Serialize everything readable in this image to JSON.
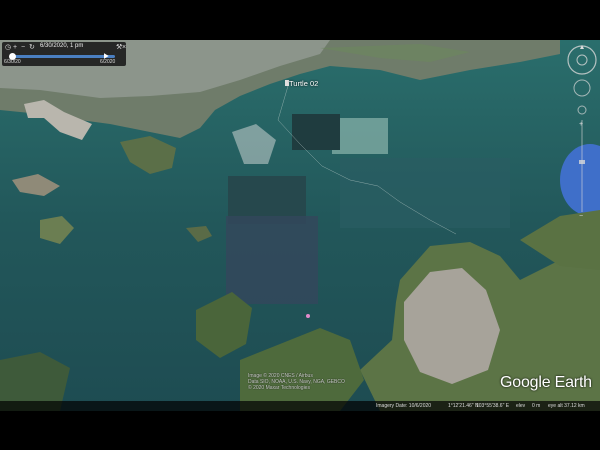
{
  "app": {
    "logo": "Google Earth"
  },
  "timebar": {
    "date_label": "6/30/2020, 1 pm",
    "start_label": "6/30/20",
    "end_label": "6/2020",
    "progress": 0.92
  },
  "placemark": {
    "label": "Turtle 02",
    "icon": "placemark-icon"
  },
  "copyright": {
    "line1": "Image © 2020 CNES / Airbus",
    "line2": "Data SIO, NOAA, U.S. Navy, NGA, GEBCO",
    "line3": "© 2020 Maxar Technologies"
  },
  "status_bar": {
    "imagery_date": "Imagery Date: 10/6/2020",
    "lat": "1°12'21.46\" N",
    "lon": "103°55'38.6\" E",
    "elev_label": "elev",
    "elev_value": "0 m",
    "eye_alt": "eye alt  37.12 km"
  },
  "colors": {
    "water": "#1f5a5a",
    "land": "#4f6d3c",
    "city": "#a7a39a",
    "accent": "#4a7fc1"
  }
}
